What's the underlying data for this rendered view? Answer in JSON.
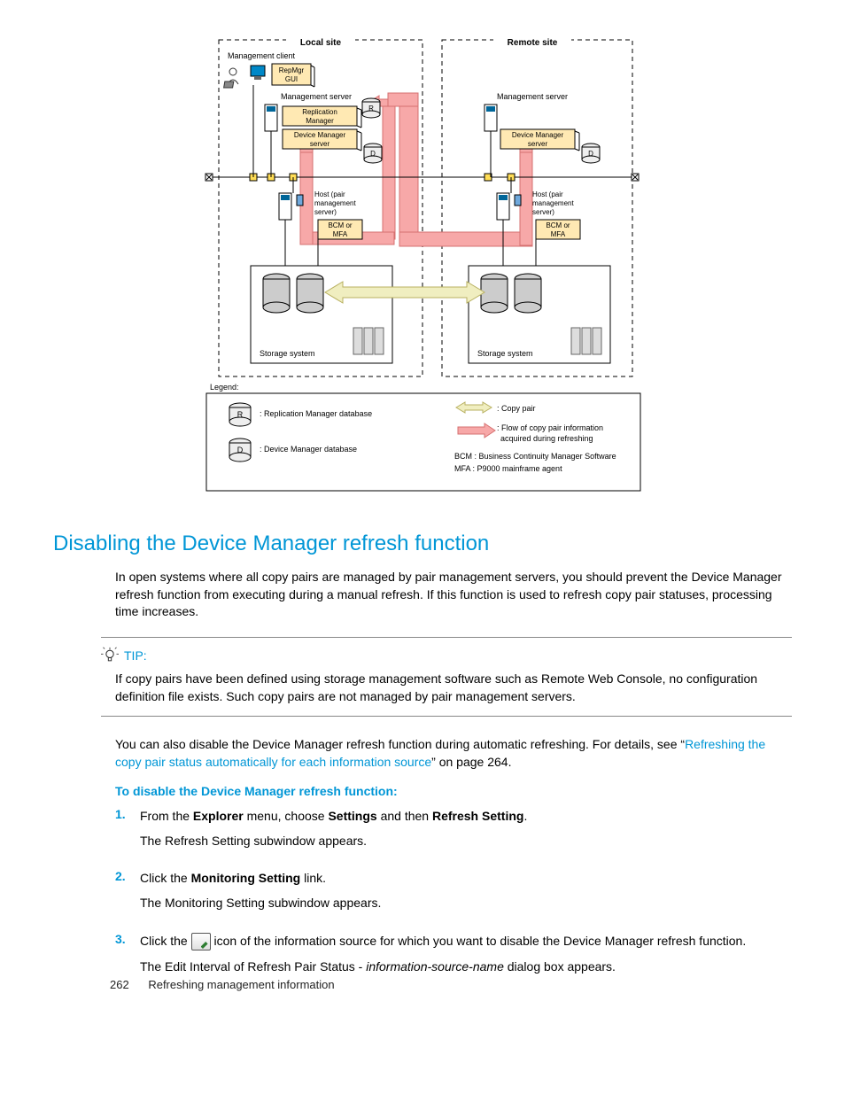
{
  "diagram": {
    "local_site": "Local site",
    "remote_site": "Remote site",
    "management_client": "Management client",
    "repmgr_gui": "RepMgr\nGUI",
    "management_server": "Management server",
    "replication_manager": "Replication\nManager",
    "device_manager_server": "Device Manager\nserver",
    "host_pair": "Host (pair\nmanagement\nserver)",
    "bcm_mfa": "BCM or\nMFA",
    "storage_system": "Storage system",
    "legend": "Legend:",
    "r": "R",
    "d": "D",
    "legend_r": ": Replication Manager database",
    "legend_d": ": Device Manager database",
    "copy_pair": ": Copy pair",
    "flow_info": ": Flow of copy pair information\n  acquired during refreshing",
    "bcm_desc": "BCM : Business Continuity Manager Software",
    "mfa_desc": "MFA : P9000 mainframe agent"
  },
  "heading": "Disabling the Device Manager refresh function",
  "para1": "In open systems where all copy pairs are managed by pair management servers, you should prevent the Device Manager refresh function from executing during a manual refresh. If this function is used to refresh copy pair statuses, processing time increases.",
  "tip_label": "TIP:",
  "tip_text": "If copy pairs have been defined using storage management software such as Remote Web Console, no configuration definition file exists. Such copy pairs are not managed by pair management servers.",
  "para2_pre": "You can also disable the Device Manager refresh function during automatic refreshing. For details, see “",
  "para2_link": "Refreshing the copy pair status automatically for each information source",
  "para2_post": "” on page 264.",
  "subhead": "To disable the Device Manager refresh function:",
  "steps": [
    {
      "num": "1.",
      "line1_pre": "From the ",
      "line1_b1": "Explorer",
      "line1_mid1": " menu, choose ",
      "line1_b2": "Settings",
      "line1_mid2": " and then ",
      "line1_b3": "Refresh Setting",
      "line1_post": ".",
      "line2": "The Refresh Setting subwindow appears."
    },
    {
      "num": "2.",
      "line1_pre": "Click the ",
      "line1_b1": "Monitoring Setting",
      "line1_post": " link.",
      "line2": "The Monitoring Setting subwindow appears."
    },
    {
      "num": "3.",
      "line1_pre": "Click the ",
      "line1_post": " icon of the information source for which you want to disable the Device Manager refresh function.",
      "line2_pre": "The Edit Interval of Refresh Pair Status - ",
      "line2_ph": "information-source-name",
      "line2_post": " dialog box appears."
    }
  ],
  "footer_page": "262",
  "footer_title": "Refreshing management information"
}
